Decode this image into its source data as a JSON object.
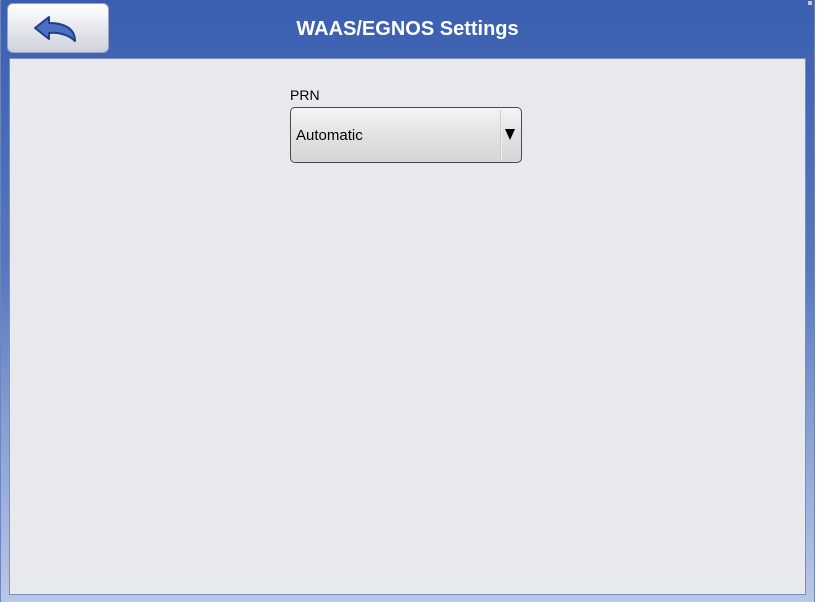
{
  "header": {
    "title": "WAAS/EGNOS Settings",
    "back_icon": "back-arrow-icon"
  },
  "prn": {
    "label": "PRN",
    "selected": "Automatic",
    "arrow_icon": "dropdown-arrow-icon"
  },
  "colors": {
    "header_blue": "#3a5fb0",
    "panel_background": "#e8e8ef",
    "title_text": "#ffffff"
  }
}
